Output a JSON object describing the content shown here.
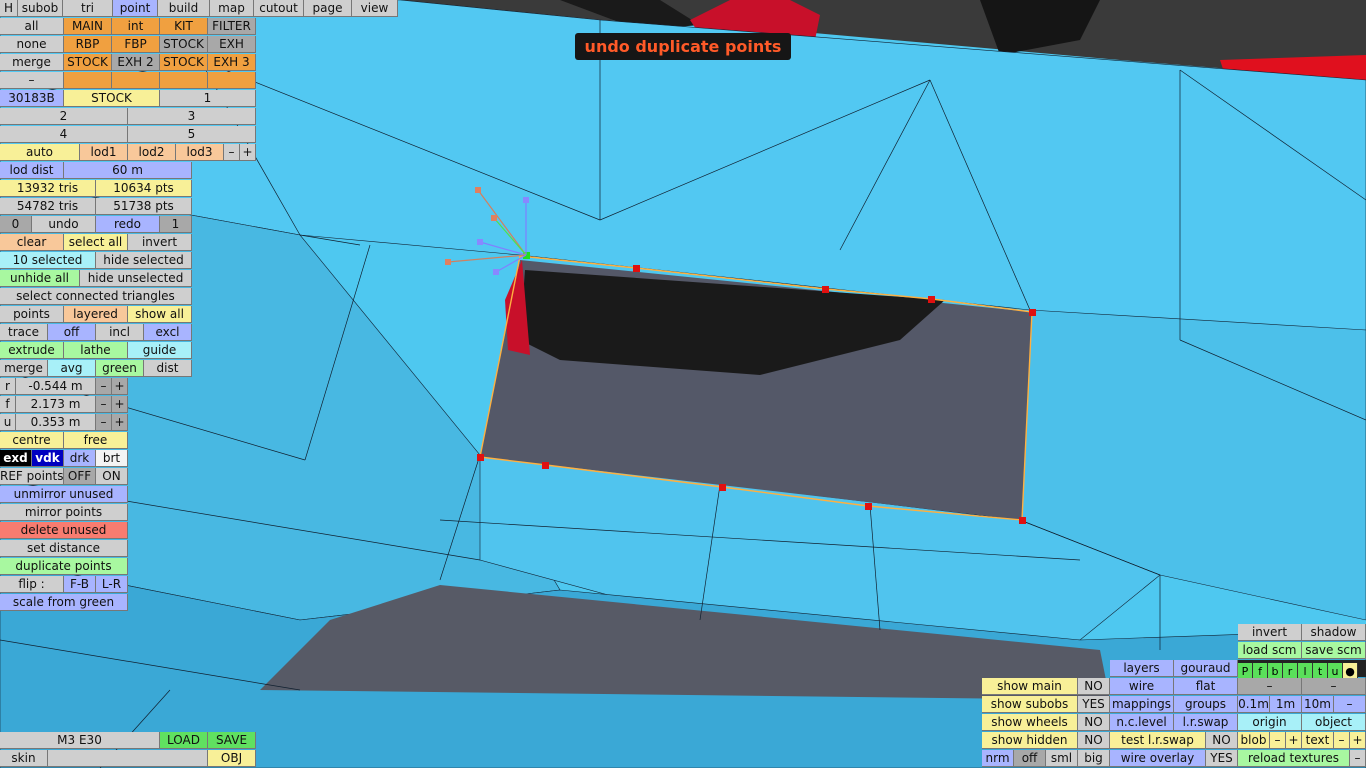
{
  "menu": [
    "H",
    "subob",
    "tri",
    "point",
    "build",
    "map",
    "cutout",
    "page",
    "view"
  ],
  "tooltip": "undo duplicate points",
  "select_rows": [
    [
      "all",
      "MAIN",
      "int",
      "KIT",
      "FILTER"
    ],
    [
      "none",
      "RBP",
      "FBP",
      "STOCK",
      "EXH"
    ],
    [
      "merge",
      "STOCK",
      "EXH 2",
      "STOCK",
      "EXH 3"
    ],
    [
      "–",
      "",
      "",
      "",
      ""
    ]
  ],
  "part": {
    "code": "30183B",
    "name": "STOCK",
    "n1": "1",
    "n2": "2",
    "n3": "3",
    "n4": "4",
    "n5": "5"
  },
  "lod": {
    "auto": "auto",
    "lod1": "lod1",
    "lod2": "lod2",
    "lod3": "lod3",
    "minus": "–",
    "plus": "+",
    "dist_label": "lod dist",
    "dist_value": "60 m"
  },
  "stats": {
    "tris1": "13932 tris",
    "pts1": "10634 pts",
    "tris2": "54782 tris",
    "pts2": "51738 pts"
  },
  "history": {
    "count": "0",
    "undo": "undo",
    "redo": "redo",
    "redo_count": "1"
  },
  "sel": {
    "clear": "clear",
    "select_all": "select all",
    "invert": "invert",
    "selected": "10 selected",
    "hide_selected": "hide selected",
    "unhide_all": "unhide all",
    "hide_unselected": "hide unselected",
    "select_connected": "select connected triangles"
  },
  "mode": {
    "points": "points",
    "layered": "layered",
    "show_all": "show all",
    "trace": "trace",
    "off": "off",
    "incl": "incl",
    "excl": "excl",
    "extrude": "extrude",
    "lathe": "lathe",
    "guide": "guide",
    "merge": "merge",
    "avg": "avg",
    "green": "green",
    "dist": "dist"
  },
  "coords": [
    {
      "axis": "r",
      "value": "-0.544 m"
    },
    {
      "axis": "f",
      "value": "2.173 m"
    },
    {
      "axis": "u",
      "value": "0.353 m"
    }
  ],
  "tools": {
    "centre": "centre",
    "free": "free",
    "exd": "exd",
    "vdk": "vdk",
    "drk": "drk",
    "brt": "brt",
    "ref": "REF points",
    "ref_off": "OFF",
    "ref_on": "ON",
    "unmirror": "unmirror unused",
    "mirror": "mirror points",
    "delete_unused": "delete unused",
    "set_distance": "set distance",
    "duplicate": "duplicate points",
    "flip": "flip :",
    "fb": "F-B",
    "lr": "L-R",
    "scale": "scale from green"
  },
  "footer": {
    "model": "M3 E30",
    "load": "LOAD",
    "save": "SAVE",
    "skin": "skin",
    "obj": "OBJ"
  },
  "rp": {
    "invert": "invert",
    "shadow": "shadow",
    "load_scm": "load scm",
    "save_scm": "save scm",
    "channels": [
      "P",
      "f",
      "b",
      "r",
      "l",
      "t",
      "u",
      "●"
    ],
    "layers": "layers",
    "gouraud": "gouraud",
    "wire": "wire",
    "flat": "flat",
    "dash": "–",
    "show_main": "show main",
    "show_subobs": "show subobs",
    "show_wheels": "show wheels",
    "show_hidden": "show hidden",
    "no": "NO",
    "yes": "YES",
    "mappings": "mappings",
    "groups": "groups",
    "g01": "0.1m",
    "g1": "1m",
    "g10": "10m",
    "minus": "–",
    "plus": "+",
    "nclevel": "n.c.level",
    "lrswap": "l.r.swap",
    "origin": "origin",
    "object": "object",
    "test_lr": "test l.r.swap",
    "blob": "blob",
    "text": "text",
    "nrm": "nrm",
    "off": "off",
    "sml": "sml",
    "big": "big",
    "wire_overlay": "wire overlay",
    "reload": "reload textures"
  }
}
